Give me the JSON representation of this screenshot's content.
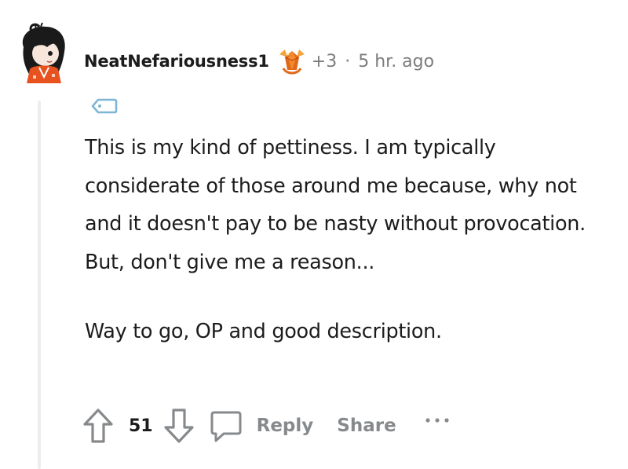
{
  "comment": {
    "username": "NeatNefariousness1",
    "award_count": "+3",
    "separator": "·",
    "timestamp": "5 hr. ago",
    "paragraphs": [
      "This is my kind of pettiness. I am typically considerate of those around me because, why not and it doesn't pay to be nasty without provocation. But, don't give me a reason...",
      "Way to go, OP and good description."
    ]
  },
  "actions": {
    "score": "51",
    "reply_label": "Reply",
    "share_label": "Share"
  },
  "icons": {
    "upvote": "arrow-up-outline-icon",
    "downvote": "arrow-down-outline-icon",
    "reply": "speech-bubble-icon",
    "more": "ellipsis-icon",
    "award": "crystal-award-icon",
    "flair": "tag-icon"
  },
  "colors": {
    "text": "#1c1c1c",
    "meta": "#7c7c7c",
    "action": "#878a8c",
    "thread_line": "#ededed",
    "avatar_shirt": "#e8521f",
    "award_orange": "#e06a1c"
  }
}
